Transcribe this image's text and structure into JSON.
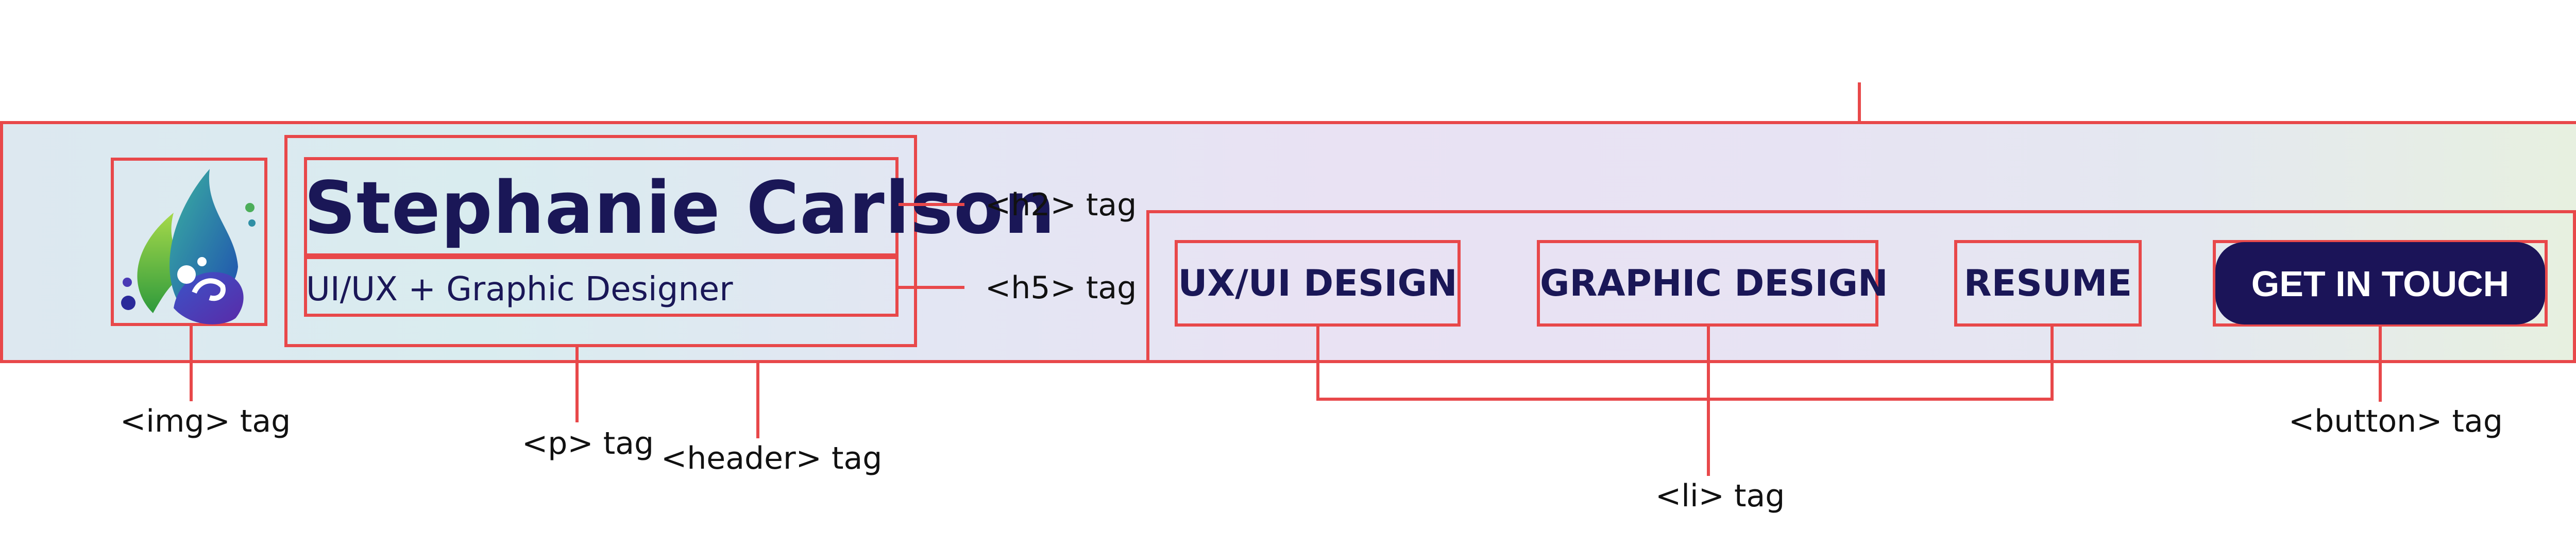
{
  "profile": {
    "name": "Stephanie Carlson",
    "role": "UI/UX + Graphic Designer"
  },
  "nav": {
    "items": [
      "UX/UI DESIGN",
      "GRAPHIC DESIGN",
      "RESUME"
    ],
    "cta": "GET IN TOUCH"
  },
  "annotations": {
    "img": "<img> tag",
    "p": "<p> tag",
    "header": "<header> tag",
    "h2": "<h2> tag",
    "h5": "<h5> tag",
    "li": "<li> tag",
    "button": "<button> tag"
  },
  "colors": {
    "annotation_red": "#e8484a",
    "text_navy": "#1a1757",
    "button_bg": "#1b1458"
  },
  "icons": [
    "leaf-wave-logo-icon"
  ]
}
